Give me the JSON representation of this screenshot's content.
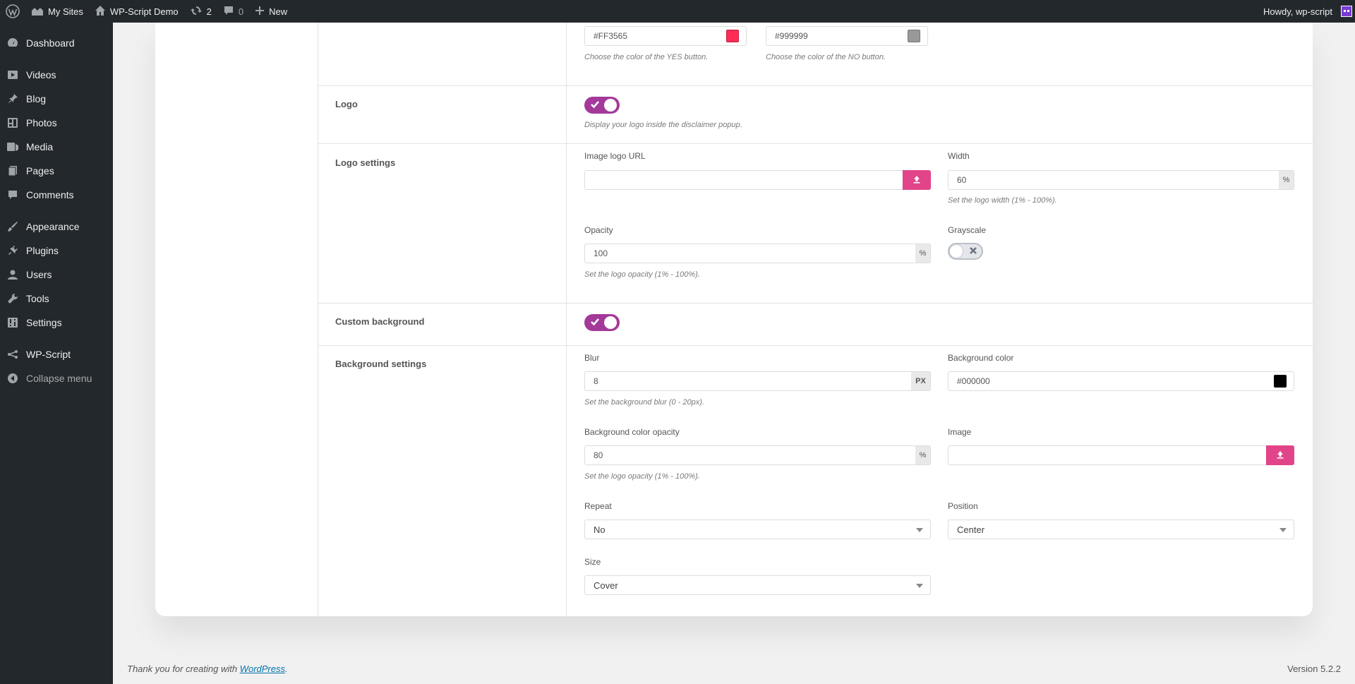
{
  "adminbar": {
    "my_sites": "My Sites",
    "site_name": "WP-Script Demo",
    "updates_count": "2",
    "comments_count": "0",
    "new_label": "New",
    "howdy": "Howdy, wp-script"
  },
  "sidebar": {
    "items": [
      {
        "label": "Dashboard",
        "icon": "dashboard-icon"
      },
      {
        "label": "Videos",
        "icon": "video-icon"
      },
      {
        "label": "Blog",
        "icon": "pin-icon"
      },
      {
        "label": "Photos",
        "icon": "photos-icon"
      },
      {
        "label": "Media",
        "icon": "media-icon"
      },
      {
        "label": "Pages",
        "icon": "pages-icon"
      },
      {
        "label": "Comments",
        "icon": "comment-icon"
      },
      {
        "label": "Appearance",
        "icon": "brush-icon"
      },
      {
        "label": "Plugins",
        "icon": "plug-icon"
      },
      {
        "label": "Users",
        "icon": "user-icon"
      },
      {
        "label": "Tools",
        "icon": "wrench-icon"
      },
      {
        "label": "Settings",
        "icon": "settings-icon"
      },
      {
        "label": "WP-Script",
        "icon": "wpscript-icon"
      },
      {
        "label": "Collapse menu",
        "icon": "collapse-icon"
      }
    ]
  },
  "buttons_colors": {
    "yes_value": "#FF3565",
    "yes_swatch": "#ff2d55",
    "yes_desc": "Choose the color of the YES button.",
    "no_value": "#999999",
    "no_swatch": "#999999",
    "no_desc": "Choose the color of the NO button."
  },
  "logo": {
    "label": "Logo",
    "enabled": true,
    "desc": "Display your logo inside the disclaimer popup."
  },
  "logo_settings": {
    "label": "Logo settings",
    "url_label": "Image logo URL",
    "url_value": "",
    "width_label": "Width",
    "width_value": "60",
    "width_unit": "%",
    "width_desc": "Set the logo width (1% - 100%).",
    "opacity_label": "Opacity",
    "opacity_value": "100",
    "opacity_unit": "%",
    "opacity_desc": "Set the logo opacity (1% - 100%).",
    "grayscale_label": "Grayscale",
    "grayscale_enabled": false
  },
  "custom_background": {
    "label": "Custom background",
    "enabled": true
  },
  "background_settings": {
    "label": "Background settings",
    "blur_label": "Blur",
    "blur_value": "8",
    "blur_unit": "PX",
    "blur_desc": "Set the background blur (0 - 20px).",
    "bgcolor_label": "Background color",
    "bgcolor_value": "#000000",
    "bgcolor_swatch": "#000000",
    "opacity_label": "Background color opacity",
    "opacity_value": "80",
    "opacity_unit": "%",
    "opacity_desc": "Set the logo opacity (1% - 100%).",
    "image_label": "Image",
    "image_value": "",
    "repeat_label": "Repeat",
    "repeat_value": "No",
    "position_label": "Position",
    "position_value": "Center",
    "size_label": "Size",
    "size_value": "Cover"
  },
  "footer": {
    "thanks": "Thank you for creating with ",
    "wp_link": "WordPress",
    "period": ".",
    "version": "Version 5.2.2"
  },
  "colors": {
    "accent_pink": "#e2448a",
    "toggle_on": "#a33a9a",
    "admin_dark": "#23282d"
  }
}
